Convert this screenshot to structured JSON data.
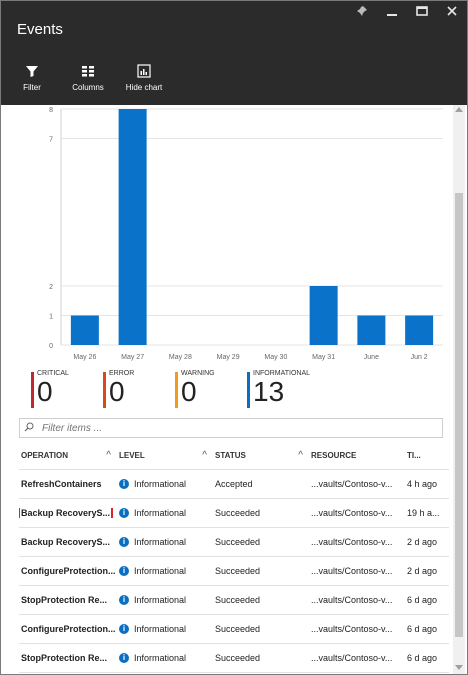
{
  "window": {
    "title": "Events",
    "controls": [
      "pin-icon",
      "minimize-icon",
      "maximize-icon",
      "close-icon"
    ]
  },
  "toolbar": {
    "filter_label": "Filter",
    "columns_label": "Columns",
    "hide_chart_label": "Hide chart"
  },
  "chart_data": {
    "type": "bar",
    "categories": [
      "May 26",
      "May 27",
      "May 28",
      "May 29",
      "May 30",
      "May 31",
      "June",
      "Jun 2"
    ],
    "values": [
      1,
      8,
      0,
      0,
      0,
      2,
      1,
      1
    ],
    "ylim": [
      0,
      8
    ],
    "y_ticks": [
      "0",
      "1",
      "2",
      "7",
      "8"
    ],
    "bar_color": "#0a72c9",
    "grid": true
  },
  "summary": {
    "critical": {
      "label": "CRITICAL",
      "count": "0",
      "color": "#c4262e"
    },
    "error": {
      "label": "ERROR",
      "count": "0",
      "color": "#d84a1b"
    },
    "warning": {
      "label": "WARNING",
      "count": "0",
      "color": "#f29b1a"
    },
    "informational": {
      "label": "INFORMATIONAL",
      "count": "13",
      "color": "#0a6fc2"
    }
  },
  "filter": {
    "placeholder": "Filter items ..."
  },
  "table": {
    "headers": [
      "OPERATION",
      "LEVEL",
      "STATUS",
      "RESOURCE",
      "TI..."
    ],
    "rows": [
      {
        "operation": "RefreshContainers",
        "level": "Informational",
        "status": "Accepted",
        "resource": "...vaults/Contoso-v...",
        "time": "4 h ago"
      },
      {
        "operation": "Backup RecoveryS...",
        "level": "Informational",
        "status": "Succeeded",
        "resource": "...vaults/Contoso-v...",
        "time": "19 h a..."
      },
      {
        "operation": "Backup RecoveryS...",
        "level": "Informational",
        "status": "Succeeded",
        "resource": "...vaults/Contoso-v...",
        "time": "2 d ago"
      },
      {
        "operation": "ConfigureProtection...",
        "level": "Informational",
        "status": "Succeeded",
        "resource": "...vaults/Contoso-v...",
        "time": "2 d ago"
      },
      {
        "operation": "StopProtection Re...",
        "level": "Informational",
        "status": "Succeeded",
        "resource": "...vaults/Contoso-v...",
        "time": "6 d ago"
      },
      {
        "operation": "ConfigureProtection...",
        "level": "Informational",
        "status": "Succeeded",
        "resource": "...vaults/Contoso-v...",
        "time": "6 d ago"
      },
      {
        "operation": "StopProtection Re...",
        "level": "Informational",
        "status": "Succeeded",
        "resource": "...vaults/Contoso-v...",
        "time": "6 d ago"
      }
    ]
  }
}
